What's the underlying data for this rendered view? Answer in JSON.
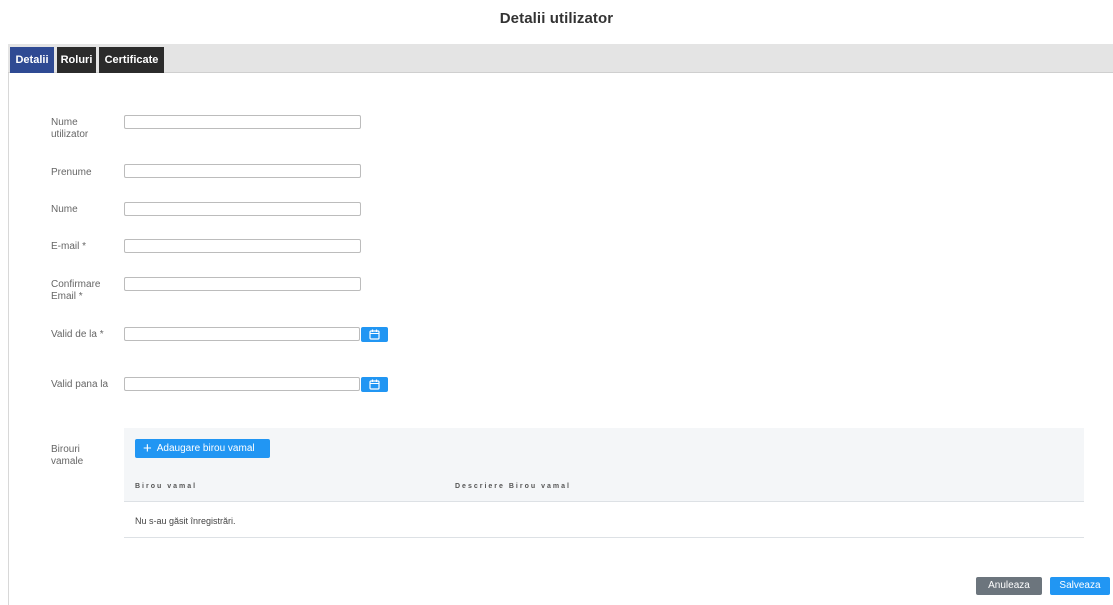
{
  "page": {
    "title": "Detalii utilizator"
  },
  "tabs": [
    {
      "label": "Detalii",
      "active": true
    },
    {
      "label": "Roluri",
      "active": false
    },
    {
      "label": "Certificate",
      "active": false
    }
  ],
  "form": {
    "username_label": "Nume utilizator",
    "prenume_label": "Prenume",
    "nume_label": "Nume",
    "email_label": "E-mail *",
    "confirm_email_label": "Confirmare Email *",
    "valid_from_label": "Valid de la *",
    "valid_until_label": "Valid pana la",
    "birouri_label": "Birouri vamale",
    "username_value": "",
    "prenume_value": "",
    "nume_value": "",
    "email_value": "",
    "confirm_email_value": "",
    "valid_from_value": "",
    "valid_until_value": ""
  },
  "birouri": {
    "add_button_label": "Adaugare birou vamal",
    "col_birou": "Birou vamal",
    "col_descriere": "Descriere Birou vamal",
    "empty_text": "Nu s-au găsit înregistrări."
  },
  "actions": {
    "cancel_label": "Anuleaza",
    "save_label": "Salveaza"
  },
  "colors": {
    "accent": "#2196f3",
    "active_tab": "#2f4a93",
    "cancel": "#6c757d"
  },
  "icons": {
    "date_picker": "calendar-icon",
    "add": "plus-icon"
  }
}
